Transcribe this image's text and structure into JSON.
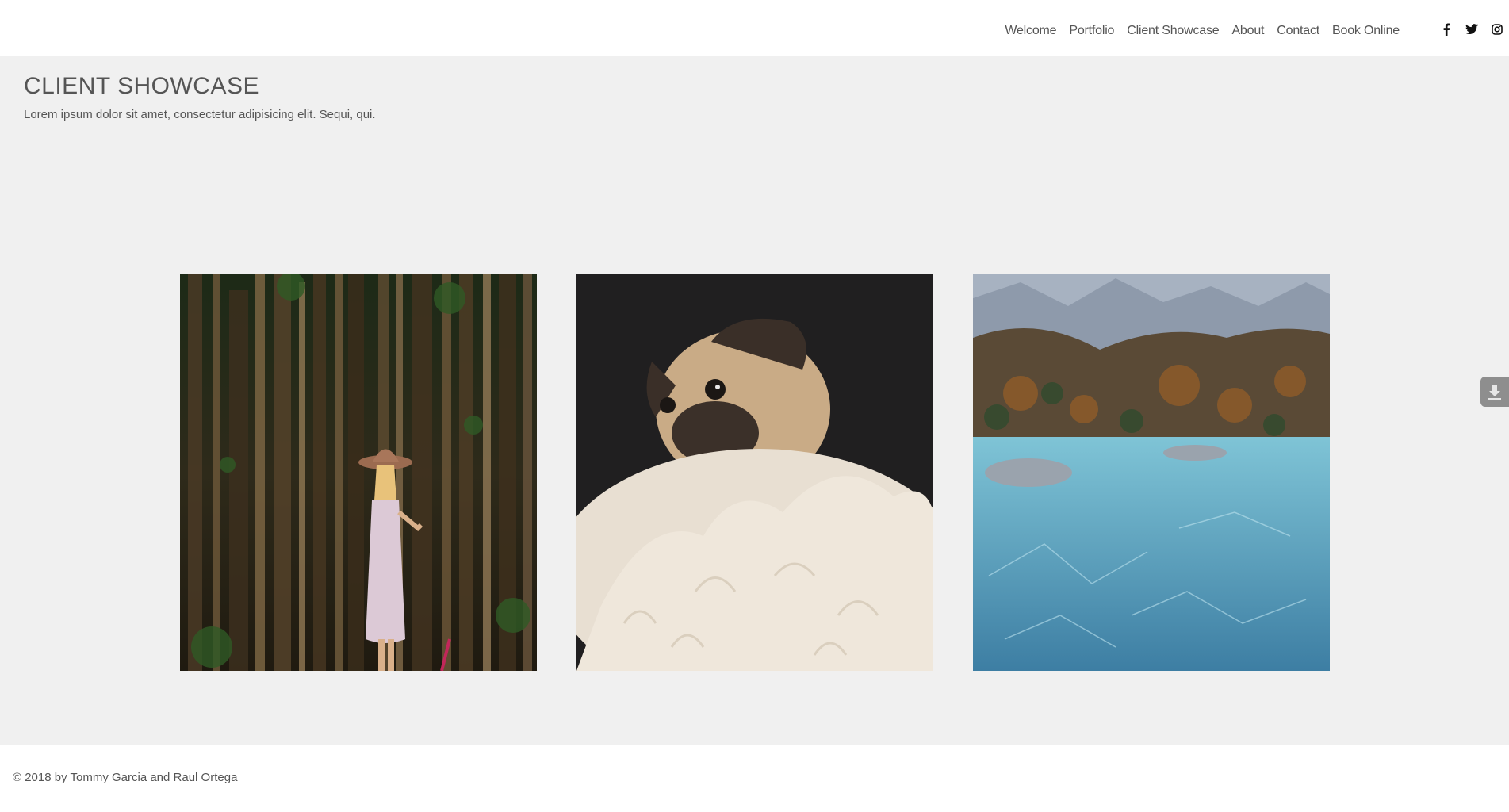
{
  "nav": {
    "items": [
      {
        "label": "Welcome"
      },
      {
        "label": "Portfolio"
      },
      {
        "label": "Client Showcase"
      },
      {
        "label": "About"
      },
      {
        "label": "Contact"
      },
      {
        "label": "Book Online"
      }
    ]
  },
  "social": {
    "icons": [
      "facebook-icon",
      "twitter-icon",
      "instagram-icon"
    ]
  },
  "page": {
    "title": "CLIENT SHOWCASE",
    "subtitle": "Lorem ipsum dolor sit amet, consectetur adipisicing elit. Sequi, qui."
  },
  "gallery": {
    "images": [
      "woman-in-forest-photo",
      "pug-in-fur-photo",
      "mountain-lake-photo"
    ]
  },
  "side_tab": {
    "icon": "download-icon"
  },
  "footer": {
    "copyright": "© 2018 by Tommy Garcia and Raul Ortega"
  },
  "colors": {
    "background": "#f0f0f0",
    "header_bg": "#ffffff",
    "text": "#555555",
    "side_tab": "#8e8e8e"
  }
}
